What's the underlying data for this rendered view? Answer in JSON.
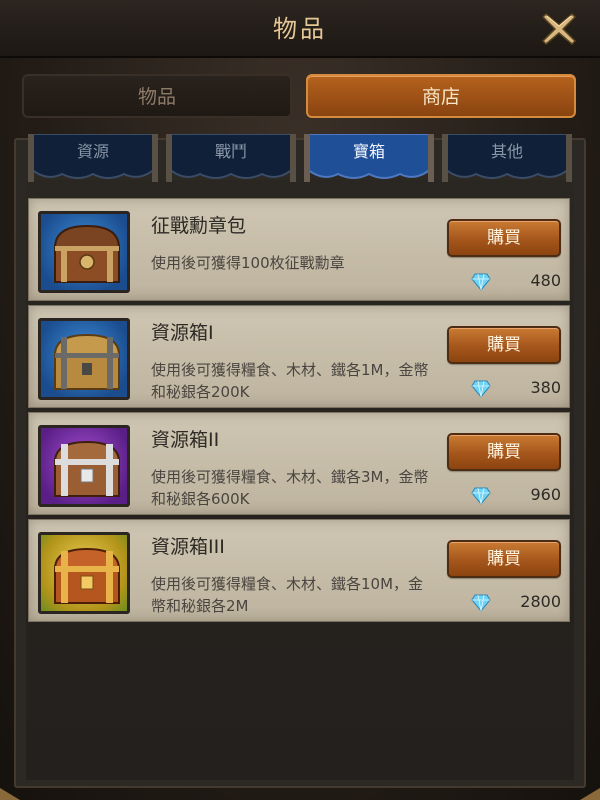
{
  "header": {
    "title": "物品"
  },
  "main_tabs": [
    {
      "label": "物品",
      "active": false
    },
    {
      "label": "商店",
      "active": true
    }
  ],
  "sub_tabs": [
    {
      "label": "資源",
      "active": false
    },
    {
      "label": "戰鬥",
      "active": false
    },
    {
      "label": "寶箱",
      "active": true
    },
    {
      "label": "其他",
      "active": false
    }
  ],
  "items": [
    {
      "name": "征戰勳章包",
      "description": "使用後可獲得100枚征戰勳章",
      "buy_label": "購買",
      "price": "480",
      "icon": "medal-chest-icon",
      "frame_color": "blue"
    },
    {
      "name": "資源箱I",
      "description": "使用後可獲得糧食、木材、鐵各1M，金幣和秘銀各200K",
      "buy_label": "購買",
      "price": "380",
      "icon": "wooden-chest-icon",
      "frame_color": "blue"
    },
    {
      "name": "資源箱II",
      "description": "使用後可獲得糧食、木材、鐵各3M，金幣和秘銀各600K",
      "buy_label": "購買",
      "price": "960",
      "icon": "silver-chest-icon",
      "frame_color": "purple"
    },
    {
      "name": "資源箱III",
      "description": "使用後可獲得糧食、木材、鐵各10M，金幣和秘銀各2M",
      "buy_label": "購買",
      "price": "2800",
      "icon": "gold-chest-icon",
      "frame_color": "yellow"
    }
  ],
  "colors": {
    "title": "#e6c796",
    "active_tab": "#a5561b",
    "sub_tab_active": "#1f4f96",
    "item_bg": "#c8bfac",
    "gem": "#5cc9f0"
  }
}
